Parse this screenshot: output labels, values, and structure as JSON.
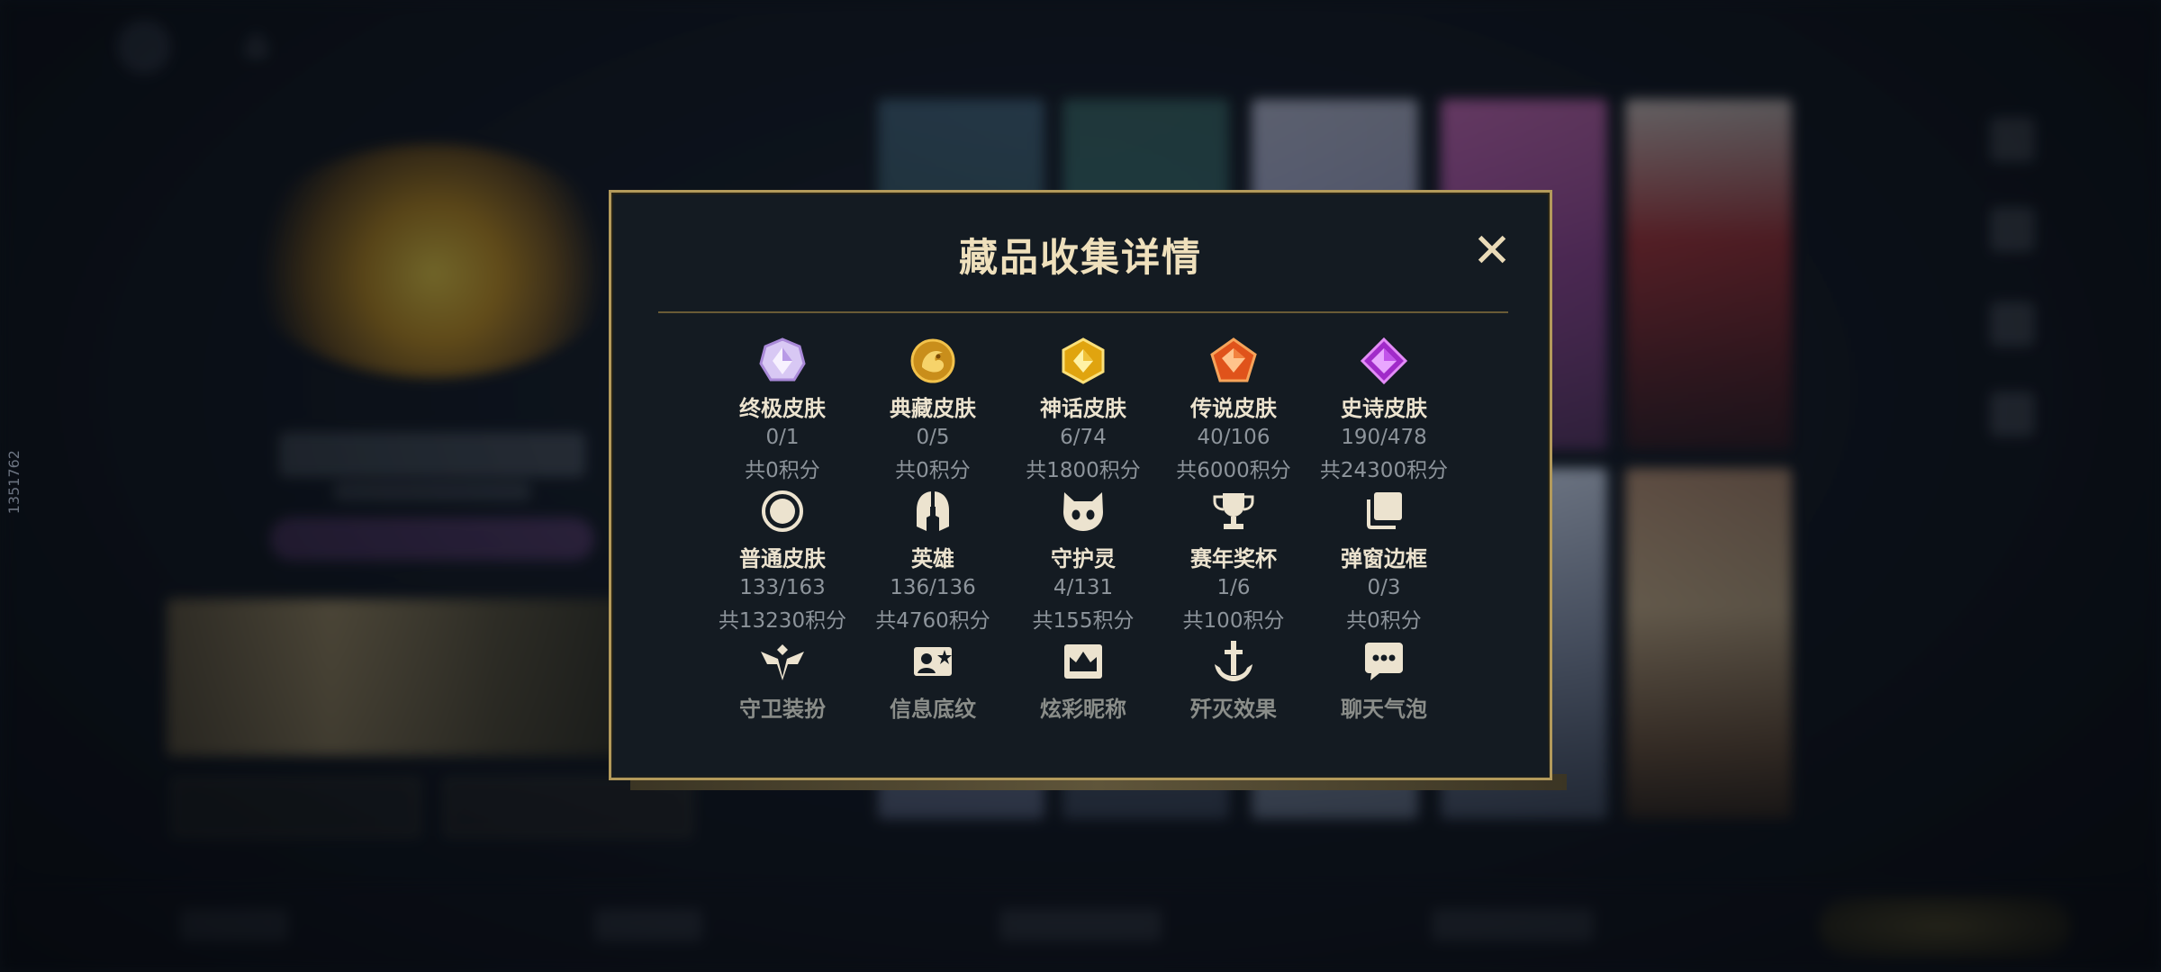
{
  "background": {
    "side_id": "1351762",
    "card_colors": [
      "#3a5a6e",
      "#2f5b56",
      "#b2b5c9",
      "#d068b8",
      "#a82b2e"
    ]
  },
  "modal": {
    "title": "藏品收集详情",
    "close_symbol": "✕",
    "border_color": "#b39a5b",
    "items": [
      {
        "icon": "ultimate-skin-icon",
        "name": "终极皮肤",
        "count": "0/1",
        "points": "共0积分"
      },
      {
        "icon": "collector-skin-icon",
        "name": "典藏皮肤",
        "count": "0/5",
        "points": "共0积分"
      },
      {
        "icon": "mythic-skin-icon",
        "name": "神话皮肤",
        "count": "6/74",
        "points": "共1800积分"
      },
      {
        "icon": "legendary-skin-icon",
        "name": "传说皮肤",
        "count": "40/106",
        "points": "共6000积分"
      },
      {
        "icon": "epic-skin-icon",
        "name": "史诗皮肤",
        "count": "190/478",
        "points": "共24300积分"
      },
      {
        "icon": "common-skin-icon",
        "name": "普通皮肤",
        "count": "133/163",
        "points": "共13230积分"
      },
      {
        "icon": "hero-helmet-icon",
        "name": "英雄",
        "count": "136/136",
        "points": "共4760积分"
      },
      {
        "icon": "guardian-spirit-icon",
        "name": "守护灵",
        "count": "4/131",
        "points": "共155积分"
      },
      {
        "icon": "season-trophy-icon",
        "name": "赛年奖杯",
        "count": "1/6",
        "points": "共100积分"
      },
      {
        "icon": "popup-frame-icon",
        "name": "弹窗边框",
        "count": "0/3",
        "points": "共0积分"
      },
      {
        "icon": "guard-outfit-icon",
        "name": "守卫装扮"
      },
      {
        "icon": "info-pattern-icon",
        "name": "信息底纹"
      },
      {
        "icon": "dazzle-nickname-icon",
        "name": "炫彩昵称"
      },
      {
        "icon": "annihilation-effect-icon",
        "name": "歼灭效果"
      },
      {
        "icon": "chat-bubble-icon",
        "name": "聊天气泡"
      }
    ]
  }
}
